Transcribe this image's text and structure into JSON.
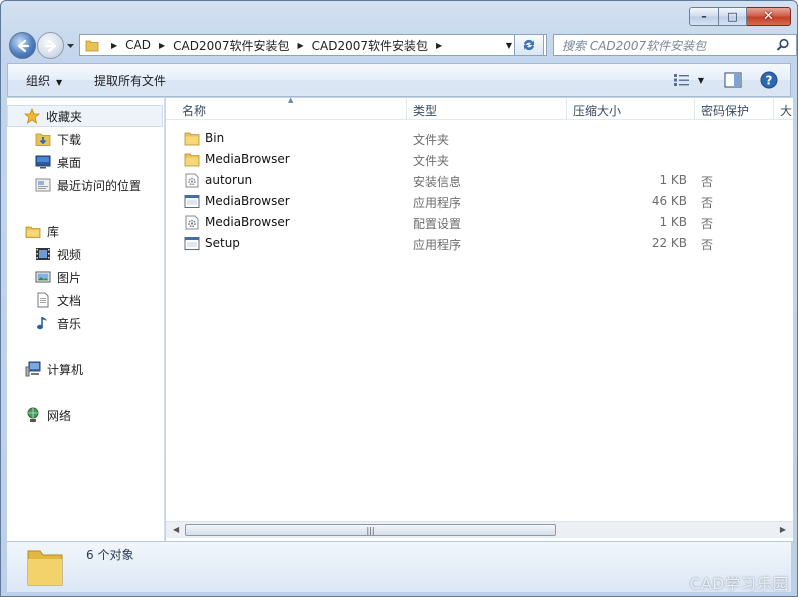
{
  "window": {
    "minimize_glyph": "–",
    "maximize_glyph": "□",
    "close_glyph": "✕"
  },
  "address": {
    "crumbs": [
      "CAD",
      "CAD2007软件安装包",
      "CAD2007软件安装包"
    ]
  },
  "search": {
    "placeholder": "搜索 CAD2007软件安装包"
  },
  "toolbar": {
    "organize_label": "组织",
    "extract_label": "提取所有文件"
  },
  "nav": {
    "favorites_label": "收藏夹",
    "favorites": [
      "下载",
      "桌面",
      "最近访问的位置"
    ],
    "library_label": "库",
    "libraries": [
      "视频",
      "图片",
      "文档",
      "音乐"
    ],
    "computer_label": "计算机",
    "network_label": "网络"
  },
  "columns": {
    "name": "名称",
    "type": "类型",
    "compressed_size": "压缩大小",
    "password": "密码保护",
    "size_partial": "大"
  },
  "files": [
    {
      "name": "Bin",
      "type": "文件夹",
      "size": "",
      "protected": "",
      "icon": "folder-icon"
    },
    {
      "name": "MediaBrowser",
      "type": "文件夹",
      "size": "",
      "protected": "",
      "icon": "folder-icon"
    },
    {
      "name": "autorun",
      "type": "安装信息",
      "size": "1 KB",
      "protected": "否",
      "icon": "setup-info-icon"
    },
    {
      "name": "MediaBrowser",
      "type": "应用程序",
      "size": "46 KB",
      "protected": "否",
      "icon": "application-icon"
    },
    {
      "name": "MediaBrowser",
      "type": "配置设置",
      "size": "1 KB",
      "protected": "否",
      "icon": "config-settings-icon"
    },
    {
      "name": "Setup",
      "type": "应用程序",
      "size": "22 KB",
      "protected": "否",
      "icon": "application-icon"
    }
  ],
  "status": {
    "count": "6 个对象"
  },
  "watermark": "CAD学习乐园"
}
